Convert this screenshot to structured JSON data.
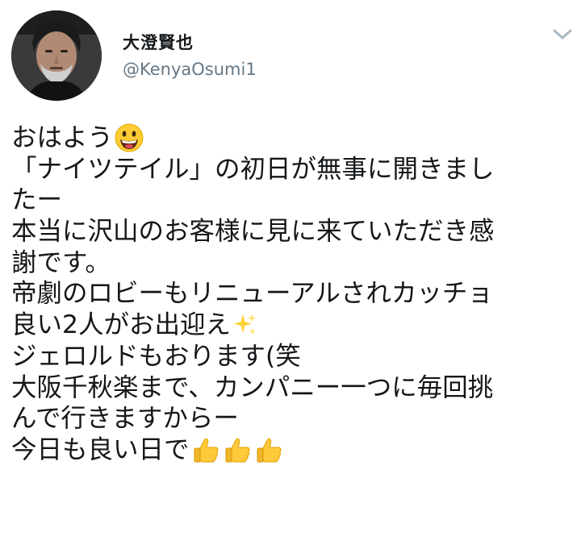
{
  "tweet": {
    "author": {
      "display_name": "大澄賢也",
      "handle": "@KenyaOsumi1",
      "avatar_icon": "avatar-photo"
    },
    "menu_icon": "chevron-down-icon",
    "lines": [
      "おはよう",
      "「ナイツテイル」の初日が無事に開きまし",
      "たー",
      "本当に沢山のお客様に見に来ていただき感",
      "謝です。",
      "帝劇のロビーもリニューアルされカッチョ",
      "良い2人がお出迎え",
      "ジェロルドもおります(笑",
      "大阪千秋楽まで、カンパニー一つに毎回挑",
      "んで行きますからー",
      "今日も良い日で"
    ],
    "emojis": {
      "smile": "grinning-face-emoji",
      "sparkles": "sparkles-emoji",
      "thumbs": [
        "thumbs-up-emoji",
        "thumbs-up-emoji",
        "thumbs-up-emoji"
      ]
    }
  },
  "colors": {
    "text": "#14171a",
    "secondary": "#657786",
    "emoji_yellow": "#ffcc33",
    "caret": "#aab8c2"
  }
}
